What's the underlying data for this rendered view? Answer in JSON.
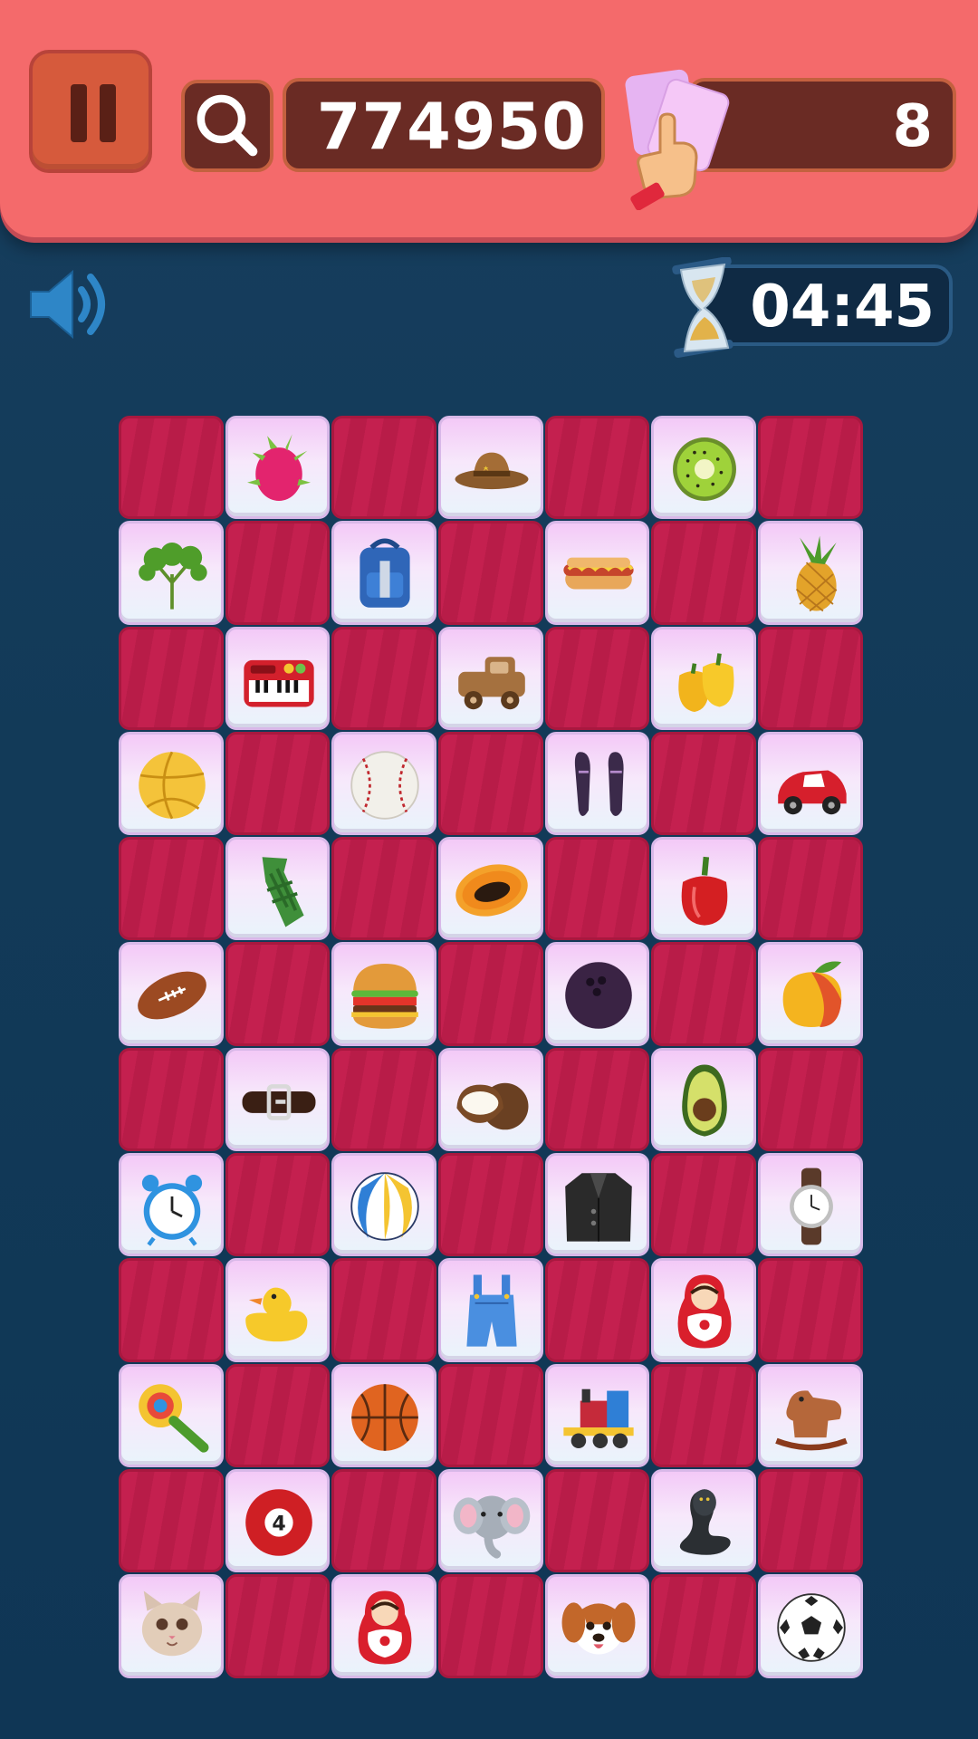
{
  "hud": {
    "score": "774950",
    "moves": "8",
    "timer": "04:45"
  },
  "board": {
    "rows": [
      [
        "",
        "dragon-fruit",
        "",
        "cowboy-hat",
        "",
        "kiwi",
        ""
      ],
      [
        "parsley",
        "",
        "backpack",
        "",
        "hot-dog",
        "",
        "pineapple"
      ],
      [
        "",
        "toy-piano",
        "",
        "toy-truck",
        "",
        "bell-peppers",
        ""
      ],
      [
        "volleyball",
        "",
        "baseball",
        "",
        "dress-shoes",
        "",
        "toy-car"
      ],
      [
        "",
        "necktie",
        "",
        "papaya",
        "",
        "red-pepper",
        ""
      ],
      [
        "football",
        "",
        "burger",
        "",
        "bowling-ball",
        "",
        "mango"
      ],
      [
        "",
        "belt",
        "",
        "coconut",
        "",
        "avocado",
        ""
      ],
      [
        "alarm-clock",
        "",
        "beach-ball",
        "",
        "coat",
        "",
        "wristwatch"
      ],
      [
        "",
        "rubber-duck",
        "",
        "overalls",
        "",
        "nesting-doll",
        ""
      ],
      [
        "baby-rattle",
        "",
        "basketball",
        "",
        "toy-train",
        "",
        "rocking-horse"
      ],
      [
        "",
        "billiard-ball",
        "",
        "elephant",
        "",
        "cobra",
        ""
      ],
      [
        "cat",
        "",
        "nesting-doll",
        "",
        "puppy",
        "",
        "soccer-ball"
      ]
    ]
  },
  "billiard_number": "4"
}
